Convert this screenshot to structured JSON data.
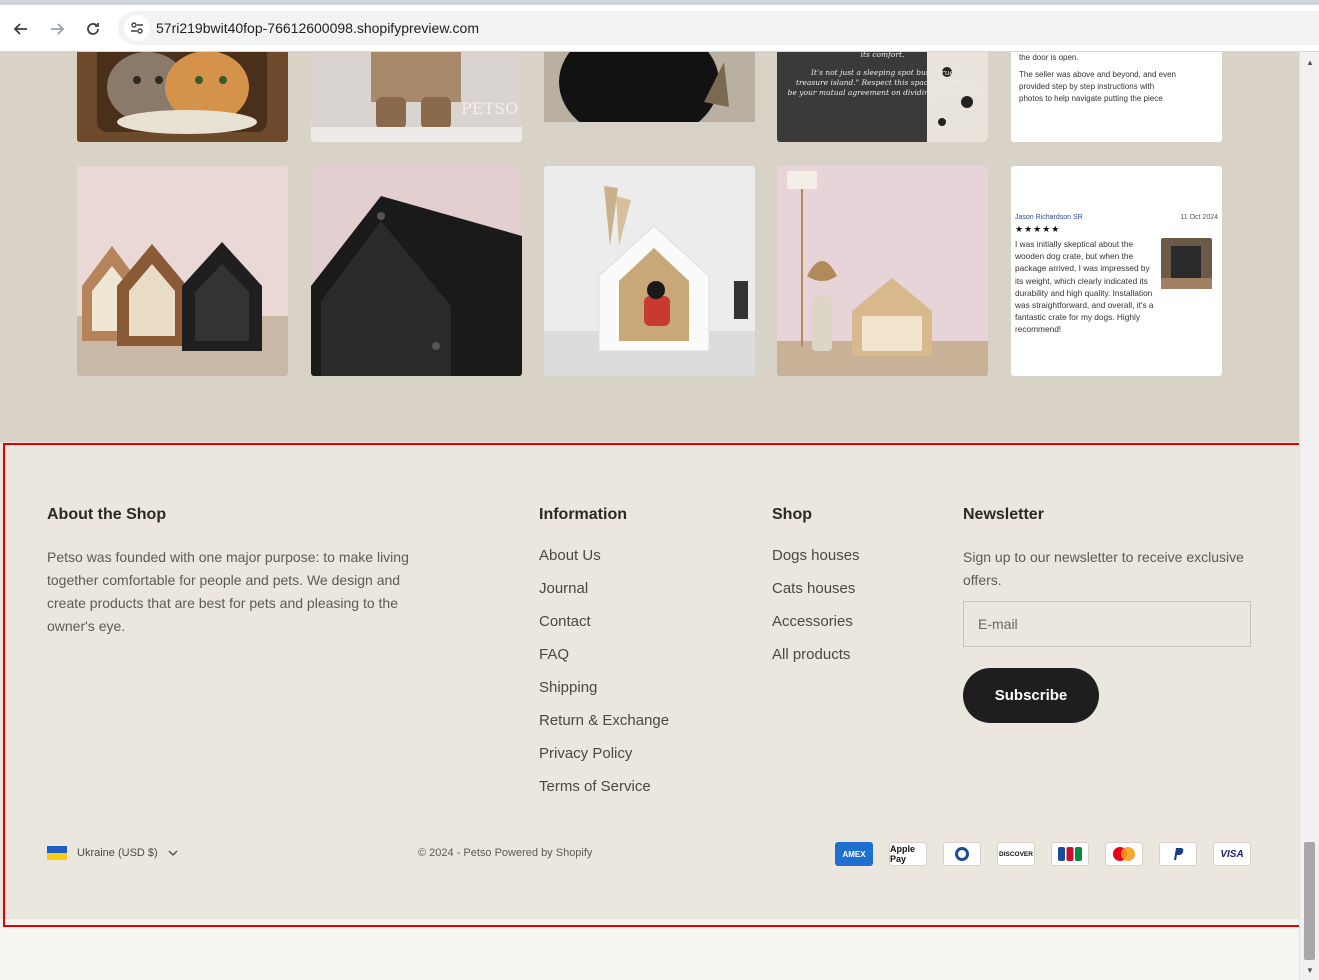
{
  "browser": {
    "url": "57ri219bwit40fop-76612600098.shopifypreview.com",
    "back_icon": "back-arrow-icon",
    "forward_icon": "forward-arrow-icon",
    "reload_icon": "reload-icon",
    "site_info_icon": "site-settings-icon"
  },
  "gallery": {
    "review_top": {
      "lines": [
        "the door is open.",
        "The seller was above and beyond, and even",
        "provided step by step instructions with",
        "photos to help navigate putting the piece"
      ]
    },
    "photo_caption_top": [
      "its comfort.",
      "It's not just a sleeping spot but a true",
      "treasure island.\" Respect this space and let it",
      "be your mutual agreement on dividing territories."
    ],
    "petso_watermark": "PETSO",
    "review": {
      "author": "Jason Richardson SR",
      "date": "11 Oct 2024",
      "stars": "★★★★★",
      "text": "I was initially skeptical about the wooden dog crate, but when the package arrived, I was impressed by its weight, which clearly indicated its durability and high quality. Installation was straightforward, and overall, it's a fantastic crate for my dogs. Highly recommend!"
    }
  },
  "footer": {
    "about": {
      "title": "About the Shop",
      "text": "Petso was founded with one major purpose: to make living together comfortable for people and pets. We design and create products that are best for pets and pleasing to the owner's eye."
    },
    "information": {
      "title": "Information",
      "links": [
        "About Us",
        "Journal",
        "Contact",
        "FAQ",
        "Shipping",
        "Return & Exchange",
        "Privacy Policy",
        "Terms of Service"
      ]
    },
    "shop": {
      "title": "Shop",
      "links": [
        "Dogs houses",
        "Cats houses",
        "Accessories",
        "All products"
      ]
    },
    "newsletter": {
      "title": "Newsletter",
      "text": "Sign up to our newsletter to receive exclusive offers.",
      "email_placeholder": "E-mail",
      "subscribe_label": "Subscribe"
    },
    "country": {
      "label": "Ukraine (USD $)",
      "flag_icon": "ukraine-flag-icon",
      "chevron_icon": "chevron-down-icon"
    },
    "copyright": "© 2024 - Petso Powered by Shopify",
    "payments": [
      "AMEX",
      "Apple Pay",
      "Diners",
      "DISCOVER",
      "JCB",
      "Mastercard",
      "PayPal",
      "VISA"
    ]
  },
  "colors": {
    "footer_bg": "#ebe7df",
    "gallery_bg": "#d9d3c7",
    "button_bg": "#1e1e1e",
    "highlight": "#e00000"
  }
}
